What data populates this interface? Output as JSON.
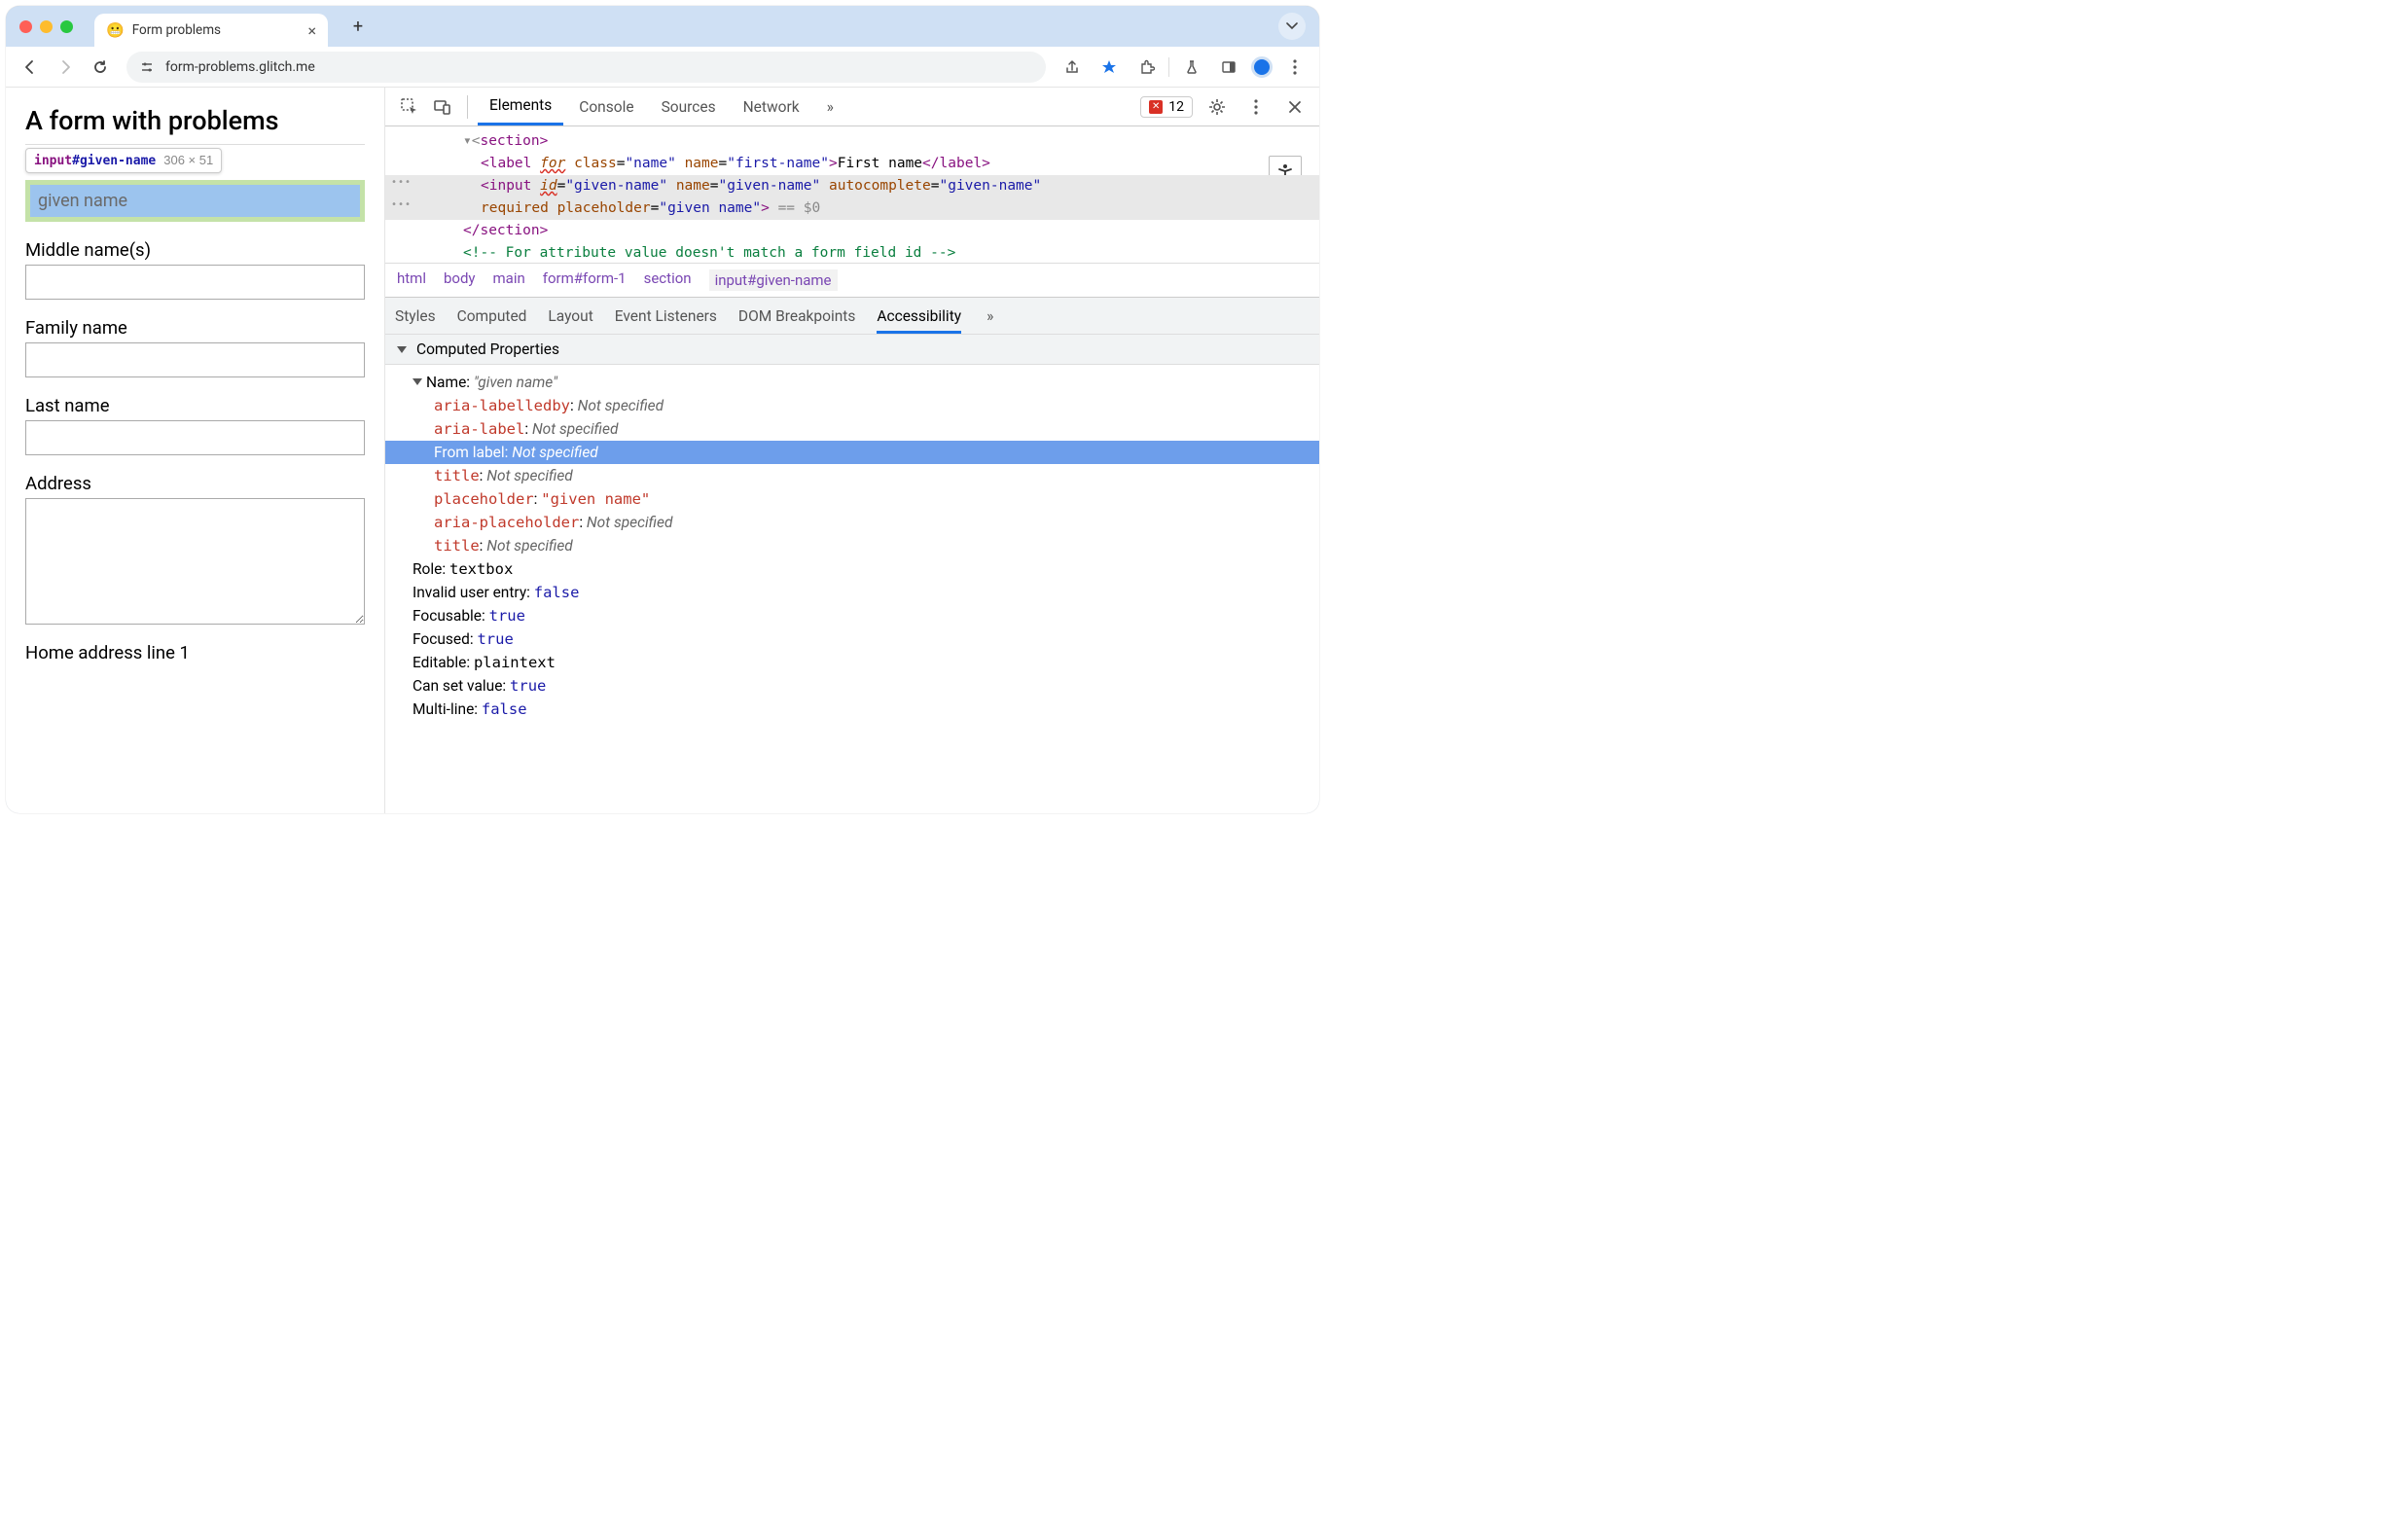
{
  "browser": {
    "tab_title": "Form problems",
    "url": "form-problems.glitch.me",
    "favicon": "😬"
  },
  "page": {
    "heading": "A form with problems",
    "tooltip_tag": "input",
    "tooltip_id": "#given-name",
    "tooltip_dim": "306 × 51",
    "first_name_label": "First name",
    "first_name_placeholder": "given name",
    "middle_label": "Middle name(s)",
    "family_label": "Family name",
    "last_label": "Last name",
    "address_label": "Address",
    "home_addr_label": "Home address line 1"
  },
  "devtools": {
    "tabs": {
      "elements": "Elements",
      "console": "Console",
      "sources": "Sources",
      "network": "Network"
    },
    "error_count": "12",
    "breadcrumb": [
      "html",
      "body",
      "main",
      "form#form-1",
      "section",
      "input#given-name"
    ],
    "side_tabs": {
      "styles": "Styles",
      "computed": "Computed",
      "layout": "Layout",
      "event": "Event Listeners",
      "dom": "DOM Breakpoints",
      "a11y": "Accessibility"
    },
    "section_title": "Computed Properties",
    "name_label": "Name: ",
    "name_value": "\"given name\"",
    "props": {
      "aria_labelledby_k": "aria-labelledby",
      "aria_labelledby_v": "Not specified",
      "aria_label_k": "aria-label",
      "aria_label_v": "Not specified",
      "from_label_k": "From label:",
      "from_label_v": "Not specified",
      "title_k": "title",
      "title_v": "Not specified",
      "placeholder_k": "placeholder",
      "placeholder_v": "\"given name\"",
      "aria_placeholder_k": "aria-placeholder",
      "aria_placeholder_v": "Not specified",
      "title2_k": "title",
      "title2_v": "Not specified"
    },
    "other_props": {
      "role_k": "Role: ",
      "role_v": "textbox",
      "invalid_k": "Invalid user entry: ",
      "invalid_v": "false",
      "focusable_k": "Focusable: ",
      "focusable_v": "true",
      "focused_k": "Focused: ",
      "focused_v": "true",
      "editable_k": "Editable: ",
      "editable_v": "plaintext",
      "cansetval_k": "Can set value: ",
      "cansetval_v": "true",
      "multiline_k": "Multi-line: ",
      "multiline_v": "false"
    },
    "code": {
      "line1_a": "▾<",
      "line1_b": "section",
      "line1_c": ">",
      "label_open": "<",
      "label_tag": "label",
      "label_for": "for",
      "label_class_attr": "class",
      "label_class_val": "\"name\"",
      "label_name_attr": "name",
      "label_name_val": "\"first-name\"",
      "label_close": ">",
      "label_text": "First name",
      "label_endopen": "</",
      "label_endclose": ">",
      "input_open": "<",
      "input_tag": "input",
      "input_id_attr": "id",
      "input_id_val": "\"given-name\"",
      "input_name_attr": "name",
      "input_name_val": "\"given-name\"",
      "input_auto_attr": "autocomplete",
      "input_auto_val": "\"given-name\"",
      "input_req": "required",
      "input_ph_attr": "placeholder",
      "input_ph_val": "\"given name\"",
      "input_close": ">",
      "eq0": " == $0",
      "section_end_open": "</",
      "section_end_tag": "section",
      "section_end_close": ">",
      "comment": "<!-- For attribute value doesn't match a form field id -->"
    }
  }
}
